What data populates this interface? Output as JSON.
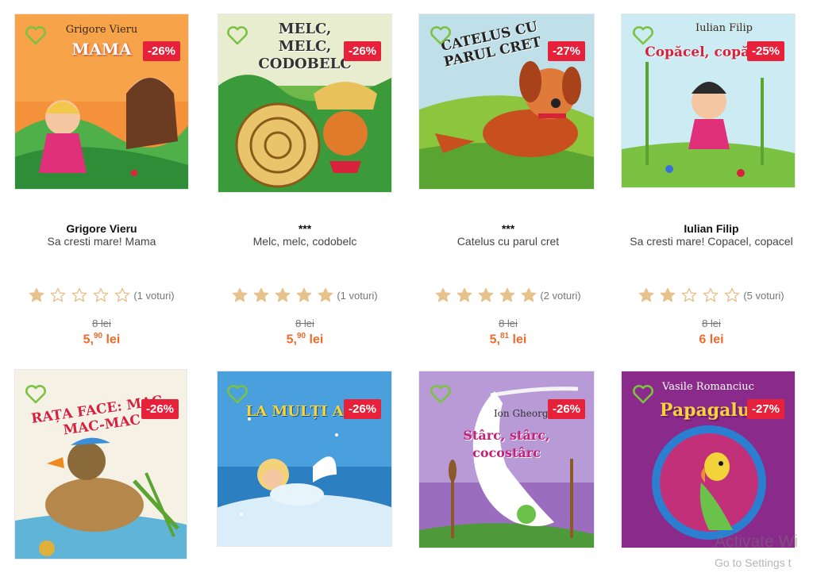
{
  "colors": {
    "accent": "#ef6a2c",
    "discount_bg": "#e8213a",
    "heart": "#7cc242",
    "star": "#e8c28c"
  },
  "products": [
    {
      "author": "Grigore Vieru",
      "title": "Sa cresti mare! Mama",
      "cover_author": "Grigore Vieru",
      "cover_title": "MAMA",
      "discount": "-26%",
      "rating": 1,
      "votes": "(1 voturi)",
      "old_price": "8 lei",
      "price_int": "5,",
      "price_dec": "90",
      "price_unit": " lei"
    },
    {
      "author": "***",
      "title": "Melc, melc, codobelc",
      "cover_author": "",
      "cover_title": "MELC, MELC, CODOBELC",
      "discount": "-26%",
      "rating": 5,
      "votes": "(1 voturi)",
      "old_price": "8 lei",
      "price_int": "5,",
      "price_dec": "90",
      "price_unit": " lei"
    },
    {
      "author": "***",
      "title": "Catelus cu parul cret",
      "cover_author": "",
      "cover_title": "CATELUS CU PARUL CRET",
      "discount": "-27%",
      "rating": 5,
      "votes": "(2 voturi)",
      "old_price": "8 lei",
      "price_int": "5,",
      "price_dec": "81",
      "price_unit": " lei"
    },
    {
      "author": "Iulian Filip",
      "title": "Sa cresti mare! Copacel, copacel",
      "cover_author": "Iulian Filip",
      "cover_title": "Copăcel, copăcel",
      "discount": "-25%",
      "rating": 2,
      "votes": "(5 voturi)",
      "old_price": "8 lei",
      "price_int": "6 lei",
      "price_dec": "",
      "price_unit": ""
    },
    {
      "cover_author": "",
      "cover_title": "RAȚA FACE: MAC-MAC-MAC",
      "discount": "-26%"
    },
    {
      "cover_author": "",
      "cover_title": "LA MULȚI ANI",
      "discount": "-26%"
    },
    {
      "cover_author": "Ion Gheorghiță",
      "cover_title": "Stârc, stârc, cocostârc",
      "discount": "-26%"
    },
    {
      "cover_author": "Vasile Romanciuc",
      "cover_title": "Papagalul",
      "discount": "-27%"
    }
  ],
  "watermark": {
    "line1": "Activate Wi",
    "line2": "Go to Settings t"
  }
}
